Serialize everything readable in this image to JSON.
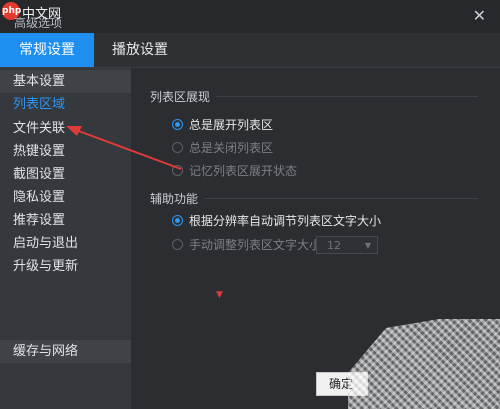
{
  "watermark": {
    "logo_text": "php",
    "site_text": "中文网"
  },
  "window": {
    "title": "高级选项",
    "close_glyph": "✕"
  },
  "tabs": [
    {
      "label": "常规设置",
      "active": true
    },
    {
      "label": "播放设置",
      "active": false
    }
  ],
  "sidebar": {
    "items": [
      {
        "label": "基本设置"
      },
      {
        "label": "列表区域",
        "selected": true
      },
      {
        "label": "文件关联"
      },
      {
        "label": "热键设置"
      },
      {
        "label": "截图设置"
      },
      {
        "label": "隐私设置"
      },
      {
        "label": "推荐设置"
      },
      {
        "label": "启动与退出"
      },
      {
        "label": "升级与更新"
      }
    ],
    "bottom_item": {
      "label": "缓存与网络"
    }
  },
  "content": {
    "list_group": {
      "title": "列表区展现",
      "options": [
        {
          "label": "总是展开列表区",
          "checked": true
        },
        {
          "label": "总是关闭列表区",
          "checked": false
        },
        {
          "label": "记忆列表区展开状态",
          "checked": false
        }
      ]
    },
    "assist_group": {
      "title": "辅助功能",
      "options": [
        {
          "label": "根据分辨率自动调节列表区文字大小",
          "checked": true
        },
        {
          "label": "手动调整列表区文字大小",
          "checked": false
        }
      ],
      "font_size_select": {
        "value": "12"
      }
    }
  },
  "footer": {
    "ok_label": "确定"
  },
  "colors": {
    "accent": "#1f8ef1",
    "annotation": "#e03a3a",
    "background": "#2b2d31"
  }
}
